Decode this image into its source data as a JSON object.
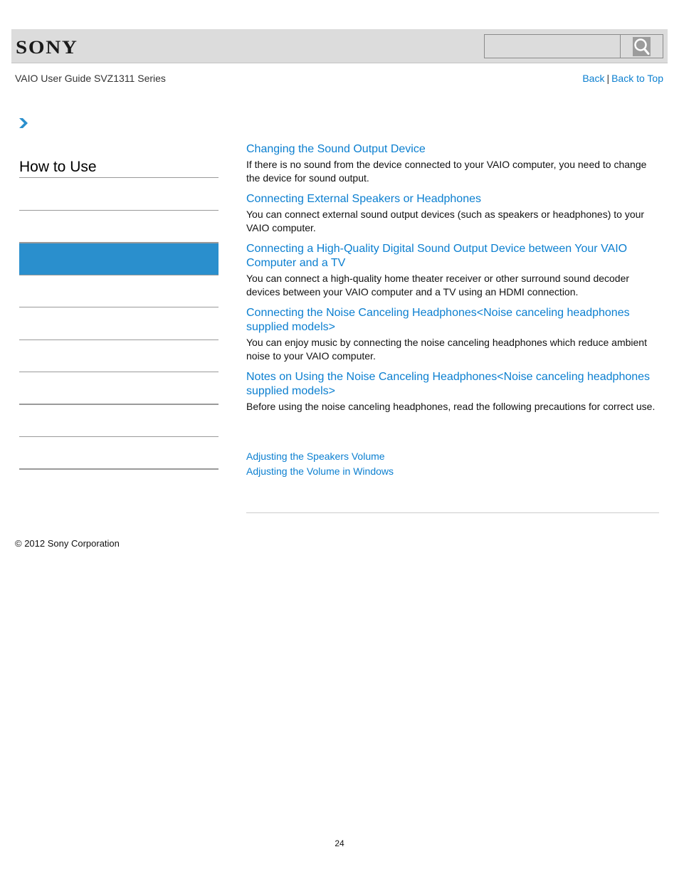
{
  "header": {
    "logo": "SONY",
    "search": {
      "placeholder": "",
      "value": "",
      "button_icon": "search-icon"
    }
  },
  "subheader": {
    "guide_title": "VAIO User Guide SVZ1311 Series",
    "nav": {
      "back_label": "Back",
      "separator": "|",
      "back_to_top_label": "Back to Top"
    }
  },
  "breadcrumb": {
    "icon": "chevron-right-icon"
  },
  "sidebar": {
    "heading": "How to Use",
    "items": [
      {
        "label": "",
        "active": false
      },
      {
        "label": "",
        "active": false
      },
      {
        "label": "",
        "active": true
      },
      {
        "label": "",
        "active": false
      },
      {
        "label": "",
        "active": false
      },
      {
        "label": "",
        "active": false
      },
      {
        "label": "",
        "active": false
      },
      {
        "label": "",
        "active": false
      },
      {
        "label": "",
        "active": false
      },
      {
        "label": "",
        "active": false
      }
    ],
    "active_color": "#2a8fcd"
  },
  "topics": [
    {
      "title": "Changing the Sound Output Device",
      "description": "If there is no sound from the device connected to your VAIO computer, you need to change the device for sound output."
    },
    {
      "title": "Connecting External Speakers or Headphones",
      "description": "You can connect external sound output devices (such as speakers or headphones) to your VAIO computer."
    },
    {
      "title": "Connecting a High-Quality Digital Sound Output Device between Your VAIO Computer and a TV",
      "description": "You can connect a high-quality home theater receiver or other surround sound decoder devices between your VAIO computer and a TV using an HDMI connection."
    },
    {
      "title": "Connecting the Noise Canceling Headphones<Noise canceling headphones supplied models>",
      "description": "You can enjoy music by connecting the noise canceling headphones which reduce ambient noise to your VAIO computer."
    },
    {
      "title": "Notes on Using the Noise Canceling Headphones<Noise canceling headphones supplied models>",
      "description": "Before using the noise canceling headphones, read the following precautions for correct use."
    }
  ],
  "related_links": [
    "Adjusting the Speakers Volume",
    "Adjusting the Volume in Windows"
  ],
  "footer": {
    "copyright": "© 2012 Sony Corporation",
    "page_number": "24"
  },
  "colors": {
    "link": "#0b7fd0",
    "header_bg": "#dcdcdc",
    "active_item": "#2a8fcd"
  }
}
